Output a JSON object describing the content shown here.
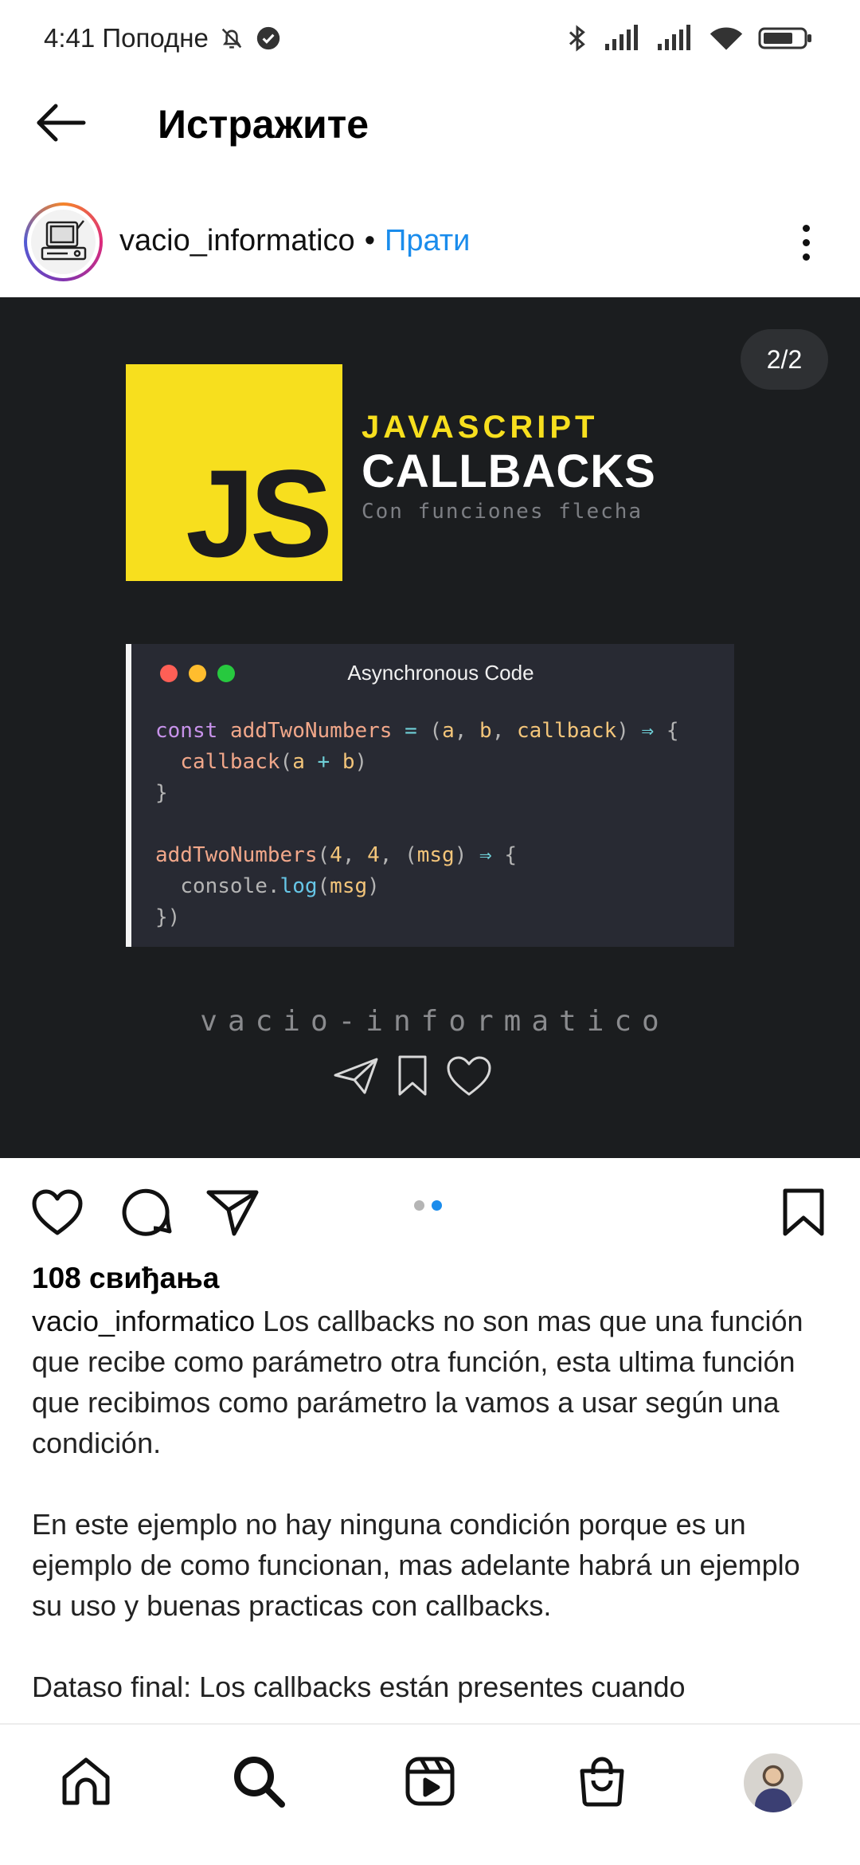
{
  "status_bar": {
    "time": "4:41 Поподне",
    "icons": [
      "mute-bell-icon",
      "check-badge-icon",
      "bluetooth-icon",
      "signal-icon",
      "signal-icon",
      "wifi-icon",
      "battery-icon"
    ]
  },
  "top_nav": {
    "title": "Истражите",
    "back_icon": "arrow-left-icon"
  },
  "post": {
    "username": "vacio_informatico",
    "separator": "•",
    "follow_label": "Прати",
    "more_icon": "more-vertical-icon",
    "media": {
      "counter": "2/2",
      "logo_text": "JS",
      "title_line1": "JAVASCRIPT",
      "title_line2": "CALLBACKS",
      "title_line3": "Con funciones flecha",
      "window_title": "Asynchronous Code",
      "window_dot_colors": [
        "#ff5f56",
        "#ffbd2e",
        "#27c93f"
      ],
      "code_lines": [
        "const addTwoNumbers = (a, b, callback) ⇒ {",
        "  callback(a + b)",
        "}",
        "",
        "addTwoNumbers(4, 4, (msg) ⇒ {",
        "  console.log(msg)",
        "})"
      ],
      "watermark": "vacio-informatico",
      "footer_icons": [
        "send-icon",
        "bookmark-icon",
        "heart-icon"
      ],
      "accent_yellow": "#f7df1e",
      "background": "#1b1d1f"
    },
    "actions": {
      "like_icon": "heart-icon",
      "comment_icon": "comment-icon",
      "share_icon": "send-icon",
      "save_icon": "bookmark-icon",
      "carousel_active_index": 2,
      "carousel_count": 2,
      "active_dot_color": "#1a8cec"
    },
    "likes": "108 свиђања",
    "caption_username": "vacio_informatico",
    "caption_p1": "Los callbacks no son mas que una función que recibe como parámetro otra función, esta ultima función que recibimos como parámetro la vamos a usar según una condición.",
    "caption_p2": "En este ejemplo no hay ninguna condición porque es un ejemplo de como funcionan, mas adelante habrá un ejemplo su uso y buenas practicas con callbacks.",
    "caption_p3": "Dataso final: Los callbacks están presentes cuando"
  },
  "bottom_nav": {
    "items": [
      "home-icon",
      "search-icon",
      "reels-icon",
      "shop-icon",
      "profile-avatar"
    ],
    "active": "search-icon"
  }
}
